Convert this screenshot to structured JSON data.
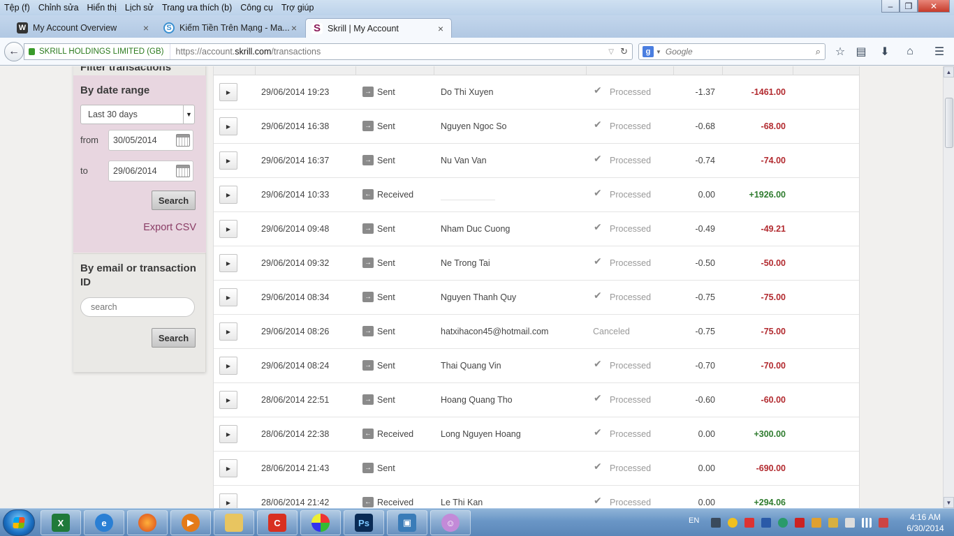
{
  "browser": {
    "menu": [
      "Tệp (f)",
      "Chỉnh sửa",
      "Hiển thị",
      "Lịch sử",
      "Trang ưa thích (b)",
      "Công cụ",
      "Trợ giúp"
    ],
    "tabs": [
      {
        "title": "My Account Overview",
        "favicon": "W"
      },
      {
        "title": "Kiếm Tiền Trên Mạng - Ma...",
        "favicon": "S"
      },
      {
        "title": "Skrill | My Account",
        "favicon": "S"
      }
    ],
    "new_tab": "+",
    "identity": "SKRILL HOLDINGS LIMITED (GB)",
    "url_prefix": "https://account.",
    "url_domain": "skrill.com",
    "url_path": "/transactions",
    "search_placeholder": "Google",
    "search_engine_letter": "g"
  },
  "filter": {
    "title": "Filter transactions",
    "date_range_title": "By date range",
    "range_selected": "Last 30 days",
    "from_label": "from",
    "from_value": "30/05/2014",
    "to_label": "to",
    "to_value": "29/06/2014",
    "search_button": "Search",
    "export_label": "Export CSV",
    "email_title": "By email or transaction ID",
    "email_placeholder": "search",
    "email_search_button": "Search"
  },
  "transactions": [
    {
      "date": "29/06/2014 19:23",
      "type": "Sent",
      "party": "Do Thi Xuyen",
      "status": "Processed",
      "fee": "-1.37",
      "amount": "-1461.00"
    },
    {
      "date": "29/06/2014 16:38",
      "type": "Sent",
      "party": "Nguyen Ngoc So",
      "status": "Processed",
      "fee": "-0.68",
      "amount": "-68.00"
    },
    {
      "date": "29/06/2014 16:37",
      "type": "Sent",
      "party": "Nu Van Van",
      "status": "Processed",
      "fee": "-0.74",
      "amount": "-74.00"
    },
    {
      "date": "29/06/2014 10:33",
      "type": "Received",
      "party": "",
      "status": "Processed",
      "fee": "0.00",
      "amount": "+1926.00"
    },
    {
      "date": "29/06/2014 09:48",
      "type": "Sent",
      "party": "Nham Duc Cuong",
      "status": "Processed",
      "fee": "-0.49",
      "amount": "-49.21"
    },
    {
      "date": "29/06/2014 09:32",
      "type": "Sent",
      "party": "Ne Trong Tai",
      "status": "Processed",
      "fee": "-0.50",
      "amount": "-50.00"
    },
    {
      "date": "29/06/2014 08:34",
      "type": "Sent",
      "party": "Nguyen Thanh Quy",
      "status": "Processed",
      "fee": "-0.75",
      "amount": "-75.00"
    },
    {
      "date": "29/06/2014 08:26",
      "type": "Sent",
      "party": "hatxihacon45@hotmail.com",
      "status": "Canceled",
      "fee": "-0.75",
      "amount": "-75.00"
    },
    {
      "date": "29/06/2014 08:24",
      "type": "Sent",
      "party": "Thai Quang Vin",
      "status": "Processed",
      "fee": "-0.70",
      "amount": "-70.00"
    },
    {
      "date": "28/06/2014 22:51",
      "type": "Sent",
      "party": "Hoang Quang Tho",
      "status": "Processed",
      "fee": "-0.60",
      "amount": "-60.00"
    },
    {
      "date": "28/06/2014 22:38",
      "type": "Received",
      "party": "Long Nguyen Hoang",
      "status": "Processed",
      "fee": "0.00",
      "amount": "+300.00"
    },
    {
      "date": "28/06/2014 21:43",
      "type": "Sent",
      "party": "",
      "status": "Processed",
      "fee": "0.00",
      "amount": "-690.00"
    },
    {
      "date": "28/06/2014 21:42",
      "type": "Received",
      "party": "Le Thi Kan",
      "status": "Processed",
      "fee": "0.00",
      "amount": "+294.06"
    }
  ],
  "colors": {
    "negative": "#b22a2f",
    "positive": "#2f7c2f",
    "filter_accent": "#e8d6e0",
    "export_link": "#8a3d66"
  },
  "taskbar": {
    "lang": "EN",
    "time": "4:16 AM",
    "date": "6/30/2014",
    "apps": [
      "excel-icon",
      "ie-icon",
      "firefox-icon",
      "media-player-icon",
      "explorer-icon",
      "ccleaner-icon",
      "paint-icon",
      "photoshop-icon",
      "image-viewer-icon",
      "chat-icon"
    ],
    "photoshop_label": "Ps"
  }
}
